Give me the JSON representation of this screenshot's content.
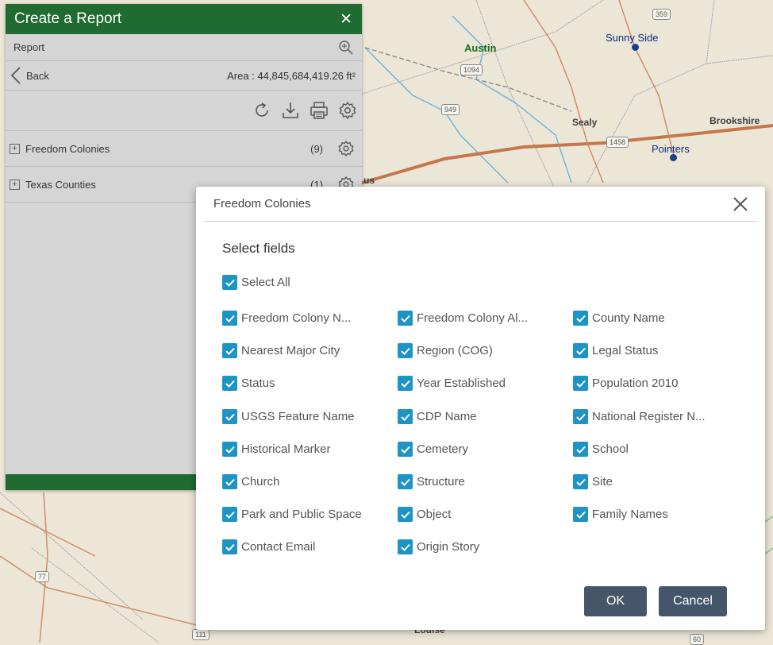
{
  "map": {
    "labels": {
      "austin": "Austin",
      "sunny_side": "Sunny Side",
      "sealy": "Sealy",
      "pointers": "Pointers",
      "brookshire": "Brookshire",
      "partial_us": "us",
      "partial_louise": "Louise"
    },
    "shields": {
      "s359": "359",
      "s1094": "1094",
      "s949": "949",
      "s1458": "1458",
      "s77": "77",
      "s111": "111",
      "s60": "60"
    }
  },
  "panel": {
    "title": "Create a Report",
    "close": "✕",
    "report_label": "Report",
    "back_label": "Back",
    "area_text": "Area : 44,845,684,419.26 ft²",
    "layers": [
      {
        "name": "Freedom Colonies",
        "count": "(9)"
      },
      {
        "name": "Texas Counties",
        "count": "(1)"
      }
    ]
  },
  "dialog": {
    "title": "Freedom Colonies",
    "close": "✕",
    "section_title": "Select fields",
    "select_all": "Select All",
    "fields": [
      "Freedom Colony N...",
      "Freedom Colony Al...",
      "County Name",
      "Nearest Major City",
      "Region (COG)",
      "Legal Status",
      "Status",
      "Year Established",
      "Population 2010",
      "USGS Feature Name",
      "CDP Name",
      "National Register N...",
      "Historical Marker",
      "Cemetery",
      "School",
      "Church",
      "Structure",
      "Site",
      "Park and Public Space",
      "Object",
      "Family Names",
      "Contact Email",
      "Origin Story"
    ],
    "ok_label": "OK",
    "cancel_label": "Cancel"
  },
  "colors": {
    "panel_header": "#1f6b31",
    "checkbox": "#1e93c5",
    "button": "#45566a"
  }
}
